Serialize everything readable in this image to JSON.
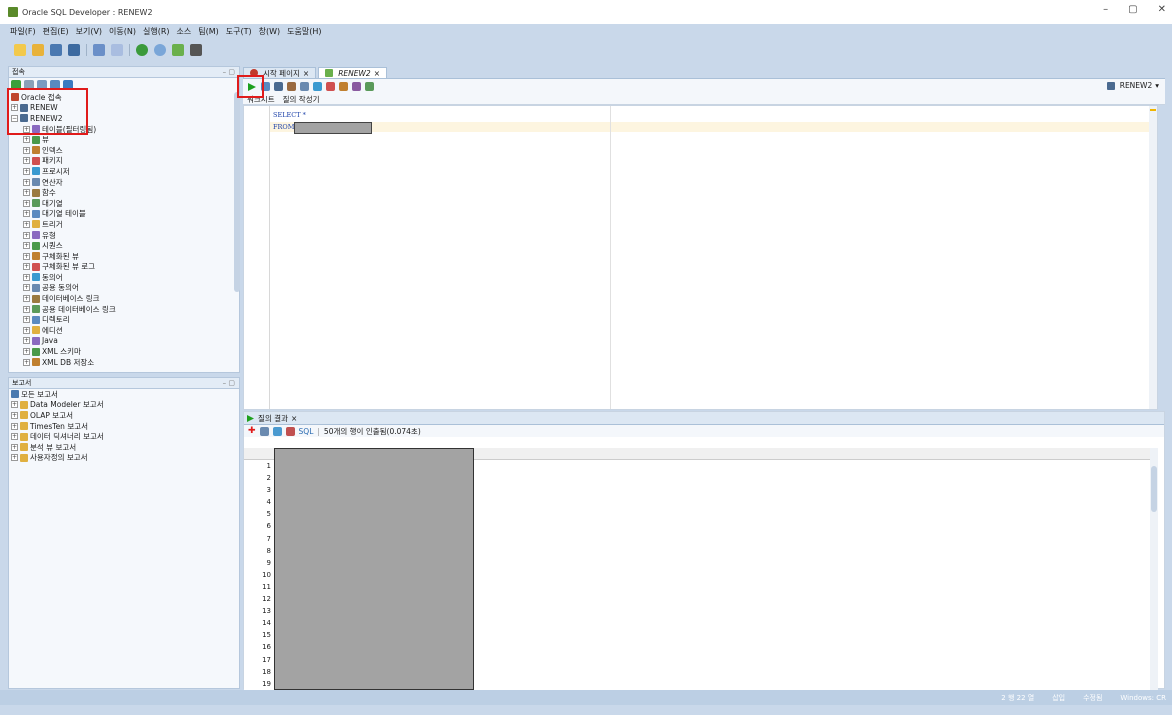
{
  "window": {
    "title": "Oracle SQL Developer : RENEW2",
    "controls": [
      "–",
      "▢",
      "✕"
    ]
  },
  "menu": [
    "파일(F)",
    "편집(E)",
    "보기(V)",
    "이동(N)",
    "실행(R)",
    "소스",
    "팀(M)",
    "도구(T)",
    "창(W)",
    "도움말(H)"
  ],
  "connections": {
    "header": "접속",
    "root": "Oracle 접속",
    "nodes": [
      {
        "label": "RENEW",
        "level": 1,
        "expanded": false
      },
      {
        "label": "RENEW2",
        "level": 1,
        "expanded": true
      },
      {
        "label": "테이블(필터링됨)",
        "level": 2
      },
      {
        "label": "뷰",
        "level": 2
      },
      {
        "label": "인덱스",
        "level": 2
      },
      {
        "label": "패키지",
        "level": 2
      },
      {
        "label": "프로시저",
        "level": 2
      },
      {
        "label": "연산자",
        "level": 2
      },
      {
        "label": "함수",
        "level": 2
      },
      {
        "label": "대기열",
        "level": 2
      },
      {
        "label": "대기열 테이블",
        "level": 2
      },
      {
        "label": "트리거",
        "level": 2
      },
      {
        "label": "유형",
        "level": 2
      },
      {
        "label": "시퀀스",
        "level": 2
      },
      {
        "label": "구체화된 뷰",
        "level": 2
      },
      {
        "label": "구체화된 뷰 로그",
        "level": 2
      },
      {
        "label": "동의어",
        "level": 2
      },
      {
        "label": "공용 동의어",
        "level": 2
      },
      {
        "label": "데이터베이스 링크",
        "level": 2
      },
      {
        "label": "공용 데이터베이스 링크",
        "level": 2
      },
      {
        "label": "디렉토리",
        "level": 2
      },
      {
        "label": "에디션",
        "level": 2
      },
      {
        "label": "Java",
        "level": 2
      },
      {
        "label": "XML 스키마",
        "level": 2
      },
      {
        "label": "XML DB 저장소",
        "level": 2
      }
    ]
  },
  "reports": {
    "header": "보고서",
    "items": [
      "모든 보고서",
      "Data Modeler 보고서",
      "OLAP 보고서",
      "TimesTen 보고서",
      "데이터 딕셔너리 보고서",
      "분석 뷰 보고서",
      "사용자정의 보고서"
    ]
  },
  "editor": {
    "tabs": [
      {
        "label": "시작 페이지",
        "active": false
      },
      {
        "label": "RENEW2",
        "active": true
      }
    ],
    "connection": "RENEW2",
    "subtabs": [
      "워크시트",
      "질의 작성기"
    ],
    "lines": [
      "SELECT *",
      "FROM"
    ]
  },
  "results": {
    "tab": "질의 결과",
    "sql_label": "SQL",
    "status": "50개의 행이 인출됨(0.074초)",
    "row_numbers": [
      "1",
      "2",
      "3",
      "4",
      "5",
      "6",
      "7",
      "8",
      "9",
      "10",
      "11",
      "12",
      "13",
      "14",
      "15",
      "16",
      "17",
      "18",
      "19"
    ]
  },
  "statusbar": [
    "2 행 22 열",
    "삽입",
    "수정됨",
    "Windows: CR"
  ],
  "colors": {
    "accent_red": "#e01b1b",
    "panel_bg": "#c9d8ea",
    "run_green": "#1ea01e"
  }
}
